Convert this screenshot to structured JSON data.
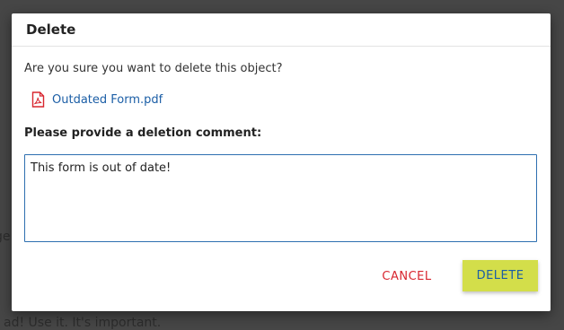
{
  "background": {
    "left_fragment": "ge",
    "bottom_fragment": "ad! Use it. It's important."
  },
  "dialog": {
    "title": "Delete",
    "question": "Are you sure you want to delete this object?",
    "file": {
      "name": "Outdated Form.pdf",
      "icon": "pdf-file-icon"
    },
    "comment_label": "Please provide a deletion comment:",
    "comment_value": "This form is out of date!",
    "cancel_label": "CANCEL",
    "delete_label": "DELETE"
  },
  "colors": {
    "link": "#1b5ea6",
    "cancel": "#d8262f",
    "delete_bg": "#d3de4a",
    "pdf_icon": "#d8262f",
    "focus_border": "#2e6fb0"
  }
}
